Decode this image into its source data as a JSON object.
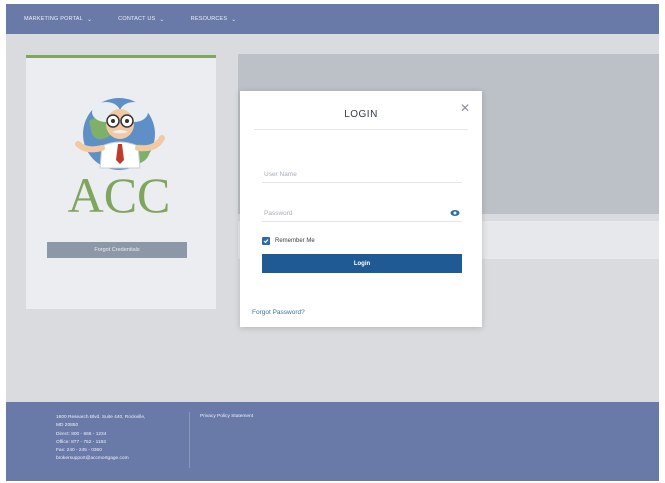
{
  "nav": {
    "items": [
      {
        "label": "MARKETING PORTAL"
      },
      {
        "label": "CONTACT US"
      },
      {
        "label": "RESOURCES"
      }
    ],
    "chevron": "⌄"
  },
  "left_card": {
    "logo_text": "ACC",
    "forgot_credentials_label": "Forgot Credentials"
  },
  "modal": {
    "title": "LOGIN",
    "close_glyph": "✕",
    "username_placeholder": "User Name",
    "password_placeholder": "Password",
    "remember_label": "Remember Me",
    "remember_checked": true,
    "login_label": "Login",
    "forgot_password_label": "Forgot Password?"
  },
  "footer": {
    "address_lines": [
      "1600 Research Blvd. Suite 440, Rockville,",
      "MD 20850",
      "Direct: 800 - 666 - 1234",
      "Office: 877 - 752 - 1193",
      "Fax: 240 - 245 - 0360",
      "brokersupport@accmortgage.com"
    ],
    "privacy_label": "Privacy Policy Statement"
  },
  "colors": {
    "nav_bg": "#6a7aa8",
    "accent_green": "#7fa55e",
    "login_button": "#1f5a95",
    "link_blue": "#3d72aa"
  }
}
